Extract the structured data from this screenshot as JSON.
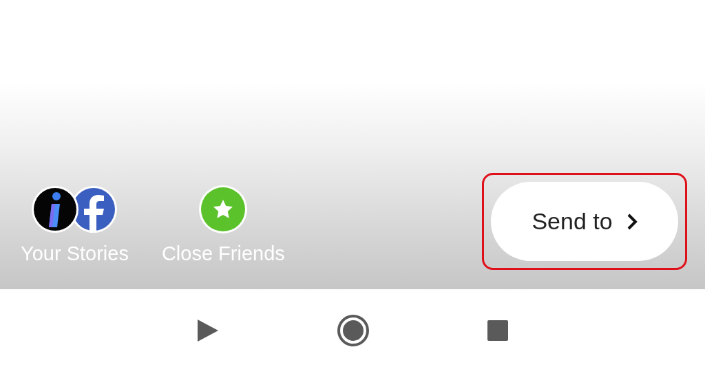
{
  "share_targets": [
    {
      "label": "Your Stories",
      "kind": "stories"
    },
    {
      "label": "Close Friends",
      "kind": "close_friends"
    }
  ],
  "send_button": {
    "label": "Send to"
  }
}
